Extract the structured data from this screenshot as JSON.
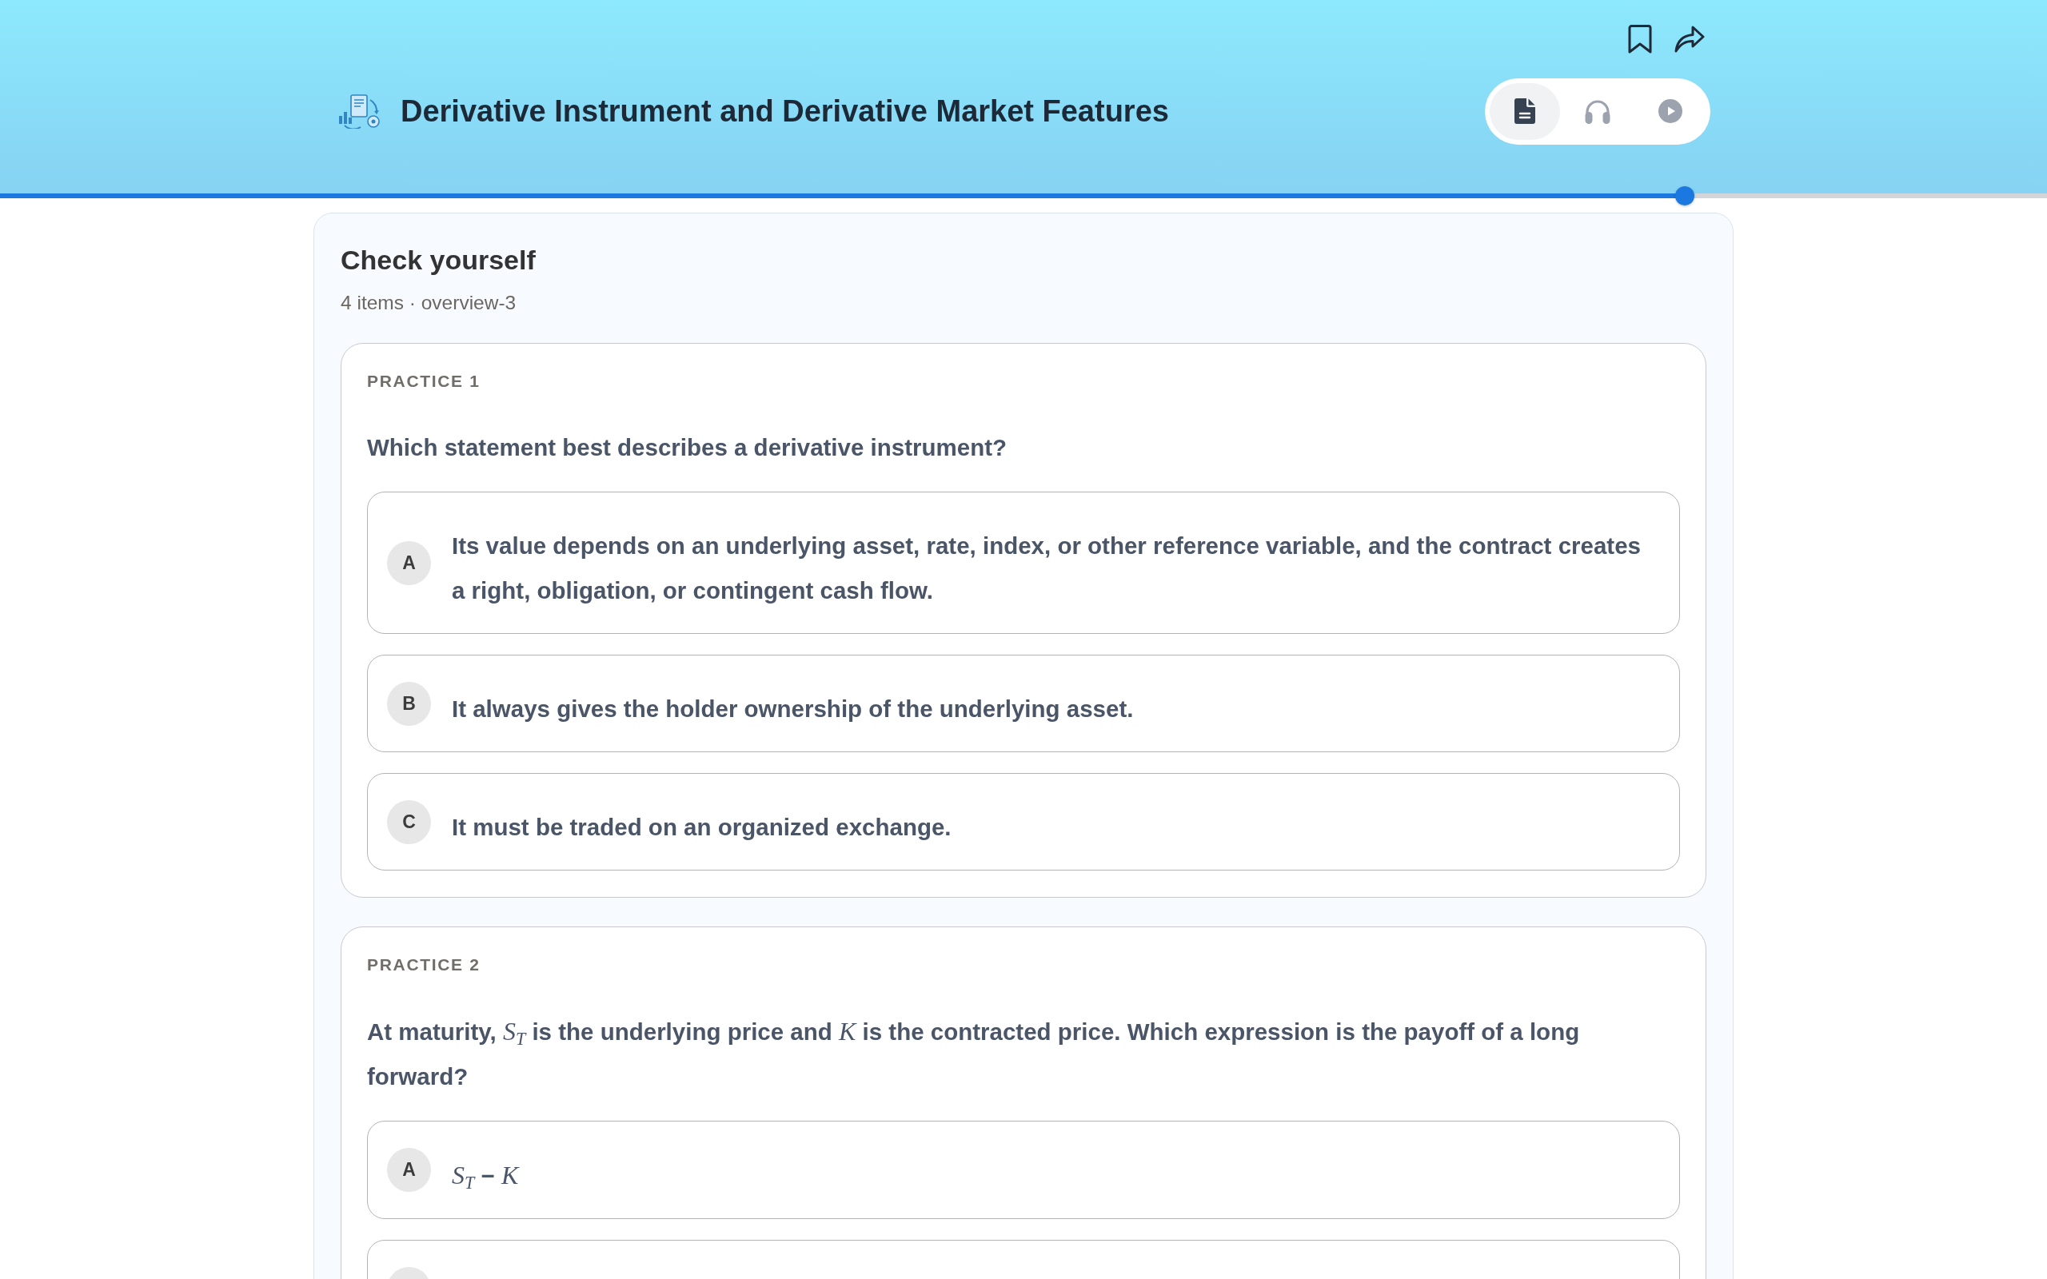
{
  "header": {
    "title": "Derivative Instrument and Derivative Market Features",
    "mode_tabs": [
      {
        "kind": "text",
        "selected": true
      },
      {
        "kind": "audio",
        "selected": false
      },
      {
        "kind": "video",
        "selected": false
      }
    ]
  },
  "progress": {
    "level": 0.823
  },
  "check": {
    "title": "Check yourself",
    "subtitle": "4 items · overview-3",
    "practices": [
      {
        "label": "PRACTICE 1",
        "question": "Which statement best describes a derivative instrument?",
        "options": [
          {
            "letter": "A",
            "text": "Its value depends on an underlying asset, rate, index, or other reference variable, and the contract creates a right, obligation, or contingent cash flow."
          },
          {
            "letter": "B",
            "text": "It always gives the holder ownership of the underlying asset."
          },
          {
            "letter": "C",
            "text": "It must be traded on an organized exchange."
          }
        ],
        "clipped_option": false
      },
      {
        "label": "PRACTICE 2",
        "question": "At maturity, *S*$_{T}$ is the underlying price and *K* is the contracted price. Which expression is the payoff of a long forward?",
        "options": [
          {
            "letter": "A",
            "text": "*S*$_{T}$ − *K*"
          }
        ],
        "clipped_option": true
      }
    ]
  }
}
